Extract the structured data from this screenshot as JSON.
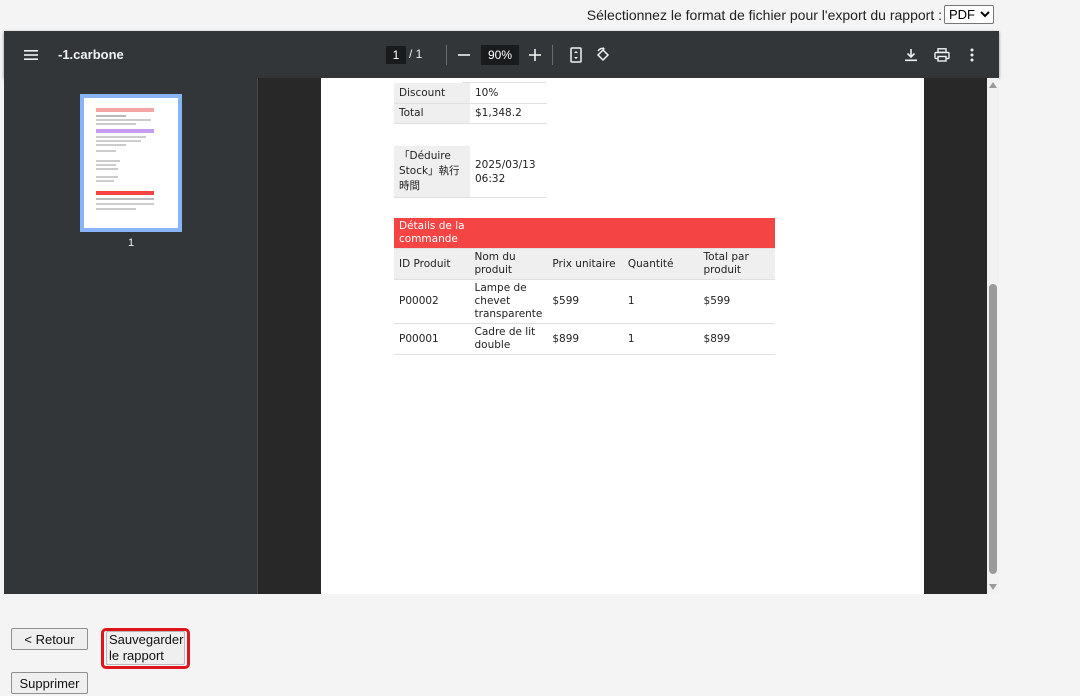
{
  "export": {
    "label": "Sélectionnez le format de fichier pour l'export du rapport :",
    "selected": "PDF"
  },
  "toolbar": {
    "title": "-1.carbone",
    "page_current": "1",
    "page_total": "/  1",
    "zoom": "90%"
  },
  "sidebar": {
    "thumb_label": "1"
  },
  "document": {
    "summary": [
      {
        "key": "Discount",
        "value": "10%"
      },
      {
        "key": "Total",
        "value": "$1,348.2"
      }
    ],
    "stock": {
      "key": "「Déduire Stock」執行時間",
      "value": "2025/03/13 06:32"
    },
    "order": {
      "title": "Détails de la commande",
      "headers": [
        "ID Produit",
        "Nom du produit",
        "Prix unitaire",
        "Quantité",
        "Total par produit"
      ],
      "rows": [
        [
          "P00002",
          "Lampe de chevet transparente",
          "$599",
          "1",
          "$599"
        ],
        [
          "P00001",
          "Cadre de lit double",
          "$899",
          "1",
          "$899"
        ]
      ]
    }
  },
  "buttons": {
    "back": "< Retour",
    "save": "Sauvegarder le rapport",
    "delete": "Supprimer"
  },
  "colors": {
    "toolbar": "#323639",
    "highlight": "#e0141b",
    "order_header": "#f44444",
    "thumb_border": "#8ab4f8"
  }
}
